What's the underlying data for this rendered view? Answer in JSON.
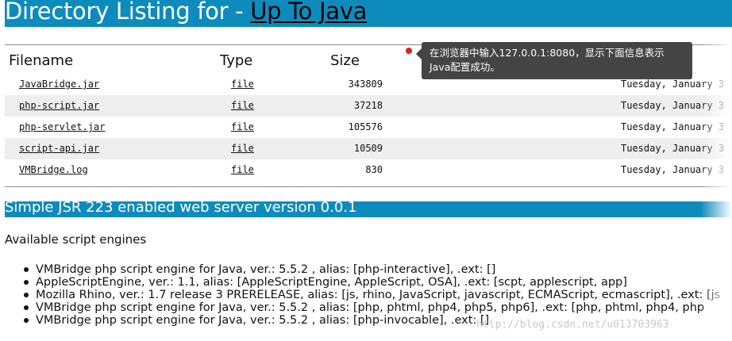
{
  "header": {
    "title_prefix": "Directory Listing for - ",
    "title_link": "Up To Java"
  },
  "table": {
    "columns": {
      "filename": "Filename",
      "type": "Type",
      "size": "Size"
    },
    "rows": [
      {
        "name": "JavaBridge.jar",
        "type": "file",
        "size": "343809",
        "date": "Tuesday, January 3"
      },
      {
        "name": "php-script.jar",
        "type": "file",
        "size": "37218",
        "date": "Tuesday, January 3"
      },
      {
        "name": "php-servlet.jar",
        "type": "file",
        "size": "105576",
        "date": "Tuesday, January 3"
      },
      {
        "name": "script-api.jar",
        "type": "file",
        "size": "10509",
        "date": "Tuesday, January 3"
      },
      {
        "name": "VMBridge.log",
        "type": "file",
        "size": "830",
        "date": "Tuesday, January 3"
      }
    ]
  },
  "tooltip": {
    "line1": "在浏览器中输入127.0.0.1:8080，显示下面信息表示",
    "line2": "Java配置成功。"
  },
  "server": {
    "version_text": "Simple JSR 223 enabled web server version 0.0.1"
  },
  "engines": {
    "heading": "Available script engines",
    "items": [
      "VMBridge php script engine for Java, ver.: 5.5.2 , alias: [php-interactive], .ext: []",
      "AppleScriptEngine, ver.: 1.1, alias: [AppleScriptEngine, AppleScript, OSA], .ext: [scpt, applescript, app]",
      "Mozilla Rhino, ver.: 1.7 release 3 PRERELEASE, alias: [js, rhino, JavaScript, javascript, ECMAScript, ecmascript], .ext: [js",
      "VMBridge php script engine for Java, ver.: 5.5.2 , alias: [php, phtml, php4, php5, php6], .ext: [php, phtml, php4, php",
      "VMBridge php script engine for Java, ver.: 5.5.2 , alias: [php-invocable], .ext: []"
    ]
  },
  "watermark": "http://blog.csdn.net/u013703963",
  "colors": {
    "header_blue": "#0e8bbd",
    "tooltip_bg": "#444444",
    "row_shade": "#eeeeee",
    "dot_red": "#e02020"
  }
}
